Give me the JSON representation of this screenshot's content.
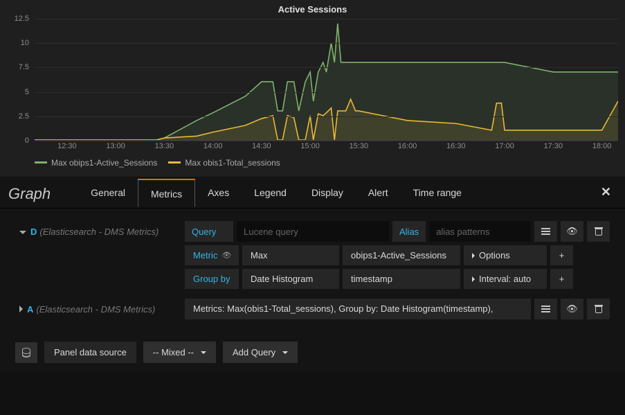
{
  "panel": {
    "title": "Active Sessions"
  },
  "chart_data": {
    "type": "line",
    "title": "Active Sessions",
    "ylim": [
      0,
      12.5
    ],
    "yticks": [
      0,
      2.5,
      5.0,
      7.5,
      10.0,
      12.5
    ],
    "xticks": [
      "12:30",
      "13:00",
      "13:30",
      "14:00",
      "14:30",
      "15:00",
      "15:30",
      "16:00",
      "16:30",
      "17:00",
      "17:30",
      "18:00"
    ],
    "x": [
      "12:10",
      "12:30",
      "13:00",
      "13:25",
      "13:30",
      "13:50",
      "14:00",
      "14:20",
      "14:30",
      "14:37",
      "14:40",
      "14:43",
      "14:46",
      "14:50",
      "14:53",
      "14:57",
      "15:00",
      "15:02",
      "15:05",
      "15:08",
      "15:10",
      "15:13",
      "15:15",
      "15:17",
      "15:19",
      "15:22",
      "15:25",
      "15:28",
      "15:30",
      "15:45",
      "16:00",
      "16:30",
      "16:52",
      "16:55",
      "16:58",
      "17:00",
      "17:30",
      "18:00",
      "18:10"
    ],
    "series": [
      {
        "name": "Max obips1-Active_Sessions",
        "color": "#7eb26d",
        "values": [
          0,
          0,
          0,
          0,
          0.2,
          2,
          2.8,
          4.5,
          6,
          6,
          3,
          3,
          6,
          6,
          3,
          6,
          7,
          4,
          7,
          8,
          7,
          10,
          8,
          12,
          8,
          8,
          8,
          8,
          8,
          8,
          8,
          8,
          8,
          8,
          8,
          8,
          7,
          7,
          7
        ]
      },
      {
        "name": "Max obis1-Total_sessions",
        "color": "#eab839",
        "values": [
          0,
          0,
          0,
          0,
          0.2,
          0.4,
          0.8,
          1.5,
          2.2,
          2.5,
          0,
          0,
          2.5,
          2.3,
          0,
          0,
          2.5,
          0,
          2.7,
          2.5,
          2.8,
          3.3,
          0,
          3,
          3,
          3,
          4.2,
          3,
          3,
          2.5,
          2,
          1.7,
          1,
          3.8,
          3.8,
          1,
          1,
          1,
          4
        ]
      }
    ],
    "legend_position": "bottom-left"
  },
  "editor": {
    "type_label": "Graph",
    "tabs": [
      "General",
      "Metrics",
      "Axes",
      "Legend",
      "Display",
      "Alert",
      "Time range"
    ],
    "active_tab": "Metrics"
  },
  "queries": [
    {
      "letter": "D",
      "datasource": "(Elasticsearch - DMS Metrics)",
      "expanded": true,
      "query_label": "Query",
      "query_placeholder": "Lucene query",
      "alias_label": "Alias",
      "alias_placeholder": "alias patterns",
      "metric_label": "Metric",
      "metric_agg": "Max",
      "metric_field": "obips1-Active_Sessions",
      "metric_opts": "Options",
      "groupby_label": "Group by",
      "groupby_type": "Date Histogram",
      "groupby_field": "timestamp",
      "groupby_interval": "Interval: auto"
    },
    {
      "letter": "A",
      "datasource": "(Elasticsearch - DMS Metrics)",
      "expanded": false,
      "summary": "Metrics: Max(obis1-Total_sessions), Group by: Date Histogram(timestamp),"
    }
  ],
  "footer": {
    "panel_ds_label": "Panel data source",
    "panel_ds_value": "-- Mixed --",
    "add_query": "Add Query"
  }
}
